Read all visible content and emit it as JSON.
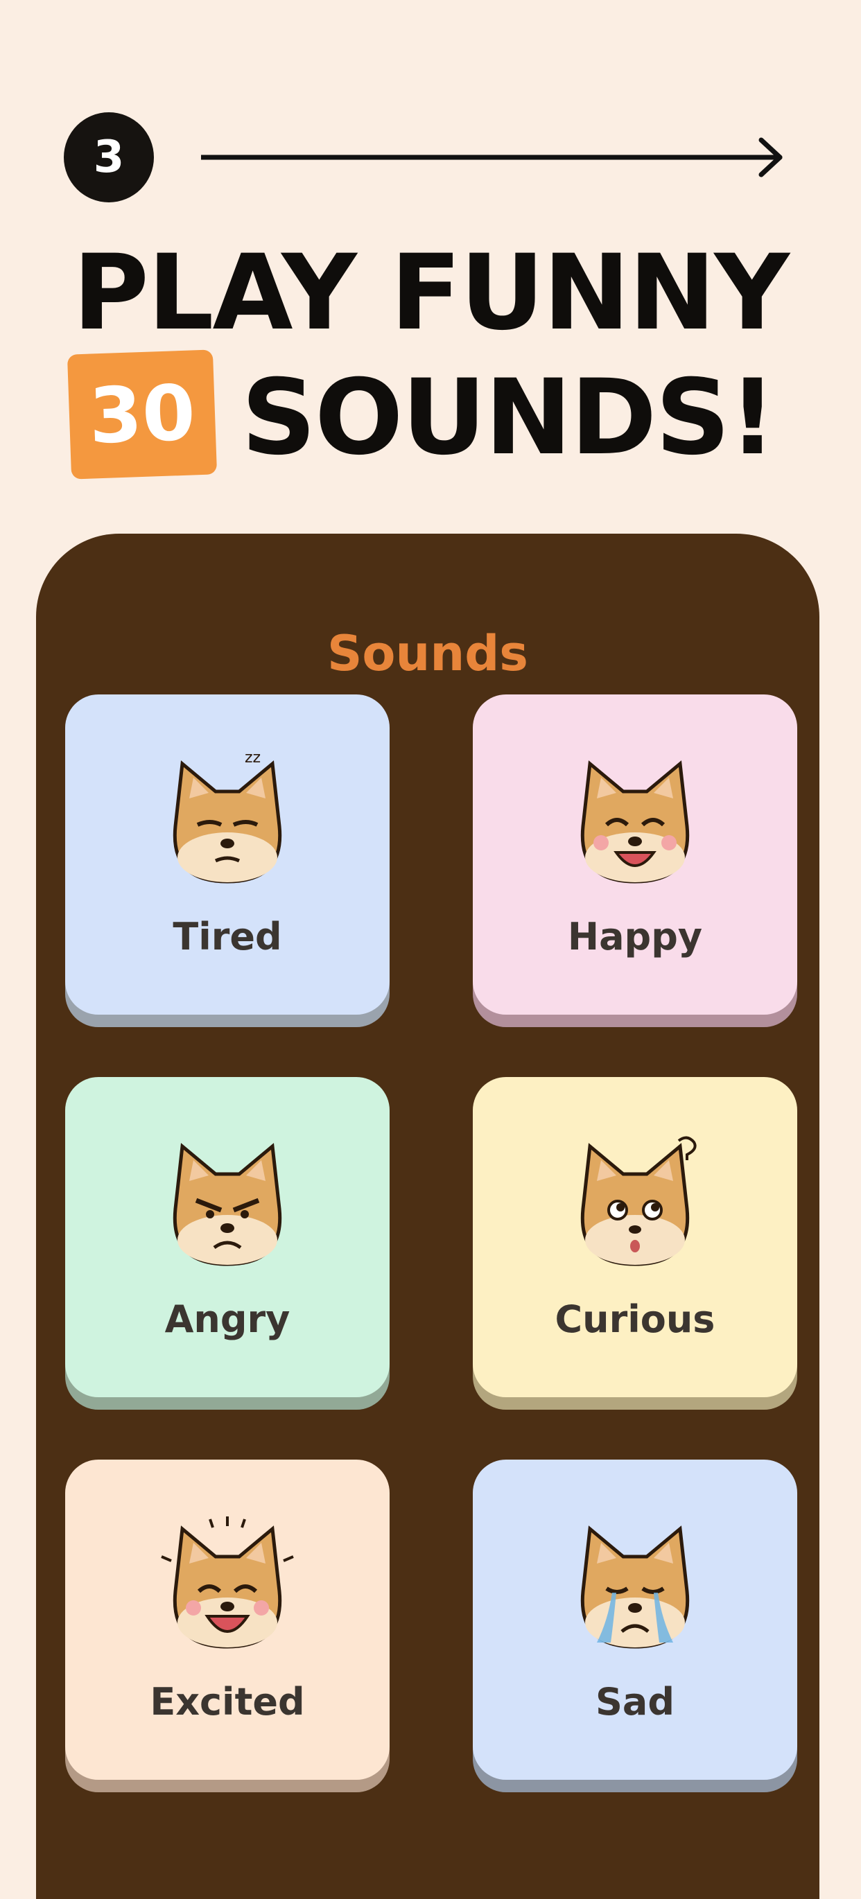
{
  "step": {
    "number": "3"
  },
  "headline": {
    "line1": "PLAY FUNNY",
    "count": "30",
    "line2": "SOUNDS!"
  },
  "panel": {
    "title": "Sounds",
    "cards": [
      {
        "label": "Tired",
        "icon": "tired-dog-icon",
        "color": "#d4e2fa",
        "shadow": "#9aa3ad"
      },
      {
        "label": "Happy",
        "icon": "happy-dog-icon",
        "color": "#f9dcea",
        "shadow": "#b3909c"
      },
      {
        "label": "Angry",
        "icon": "angry-dog-icon",
        "color": "#cff3df",
        "shadow": "#92a996"
      },
      {
        "label": "Curious",
        "icon": "curious-dog-icon",
        "color": "#fdf0c3",
        "shadow": "#b3a67e"
      },
      {
        "label": "Excited",
        "icon": "excited-dog-icon",
        "color": "#fde6d2",
        "shadow": "#b49a86"
      },
      {
        "label": "Sad",
        "icon": "sad-dog-icon",
        "color": "#d4e2fa",
        "shadow": "#8c95a3"
      }
    ]
  },
  "colors": {
    "background": "#fbeee3",
    "panel": "#4c2f14",
    "accent": "#f4983f",
    "title": "#e8853a"
  }
}
